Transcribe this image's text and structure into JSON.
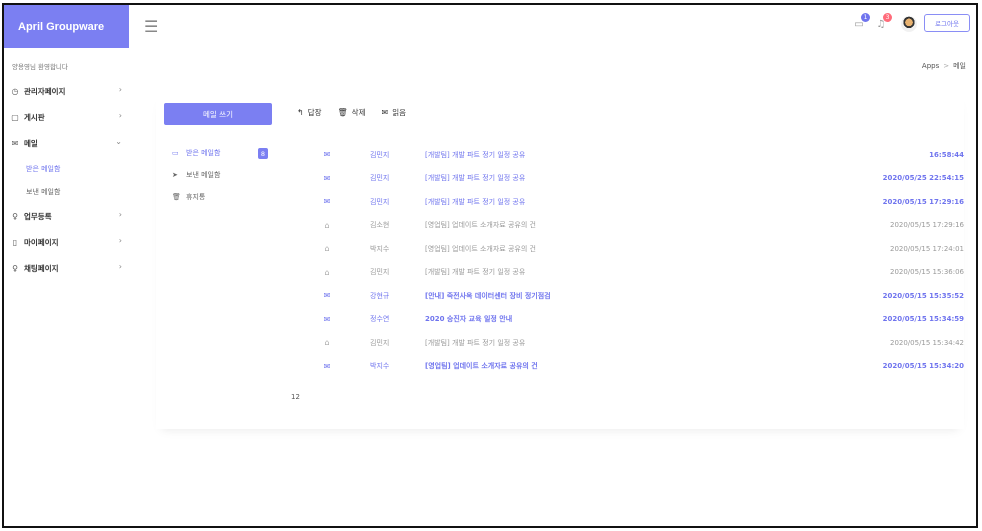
{
  "app": {
    "brand": "April Groupware",
    "welcome": "양용영님 환영합니다"
  },
  "header": {
    "mail_badge": "1",
    "bell_badge": "3",
    "logout_label": "로그아웃",
    "accent": "#7b7ff2",
    "badge_colors": [
      "#6f74ee",
      "#ff6b7a"
    ]
  },
  "breadcrumb": {
    "root": "Apps",
    "separator": ">",
    "current": "메일"
  },
  "sidebar": {
    "items": [
      {
        "label": "관리자페이지",
        "icon": "gauge-icon"
      },
      {
        "label": "게시판",
        "icon": "document-icon"
      },
      {
        "label": "메일",
        "icon": "envelope-icon"
      },
      {
        "label": "업무등록",
        "icon": "bulb-icon"
      },
      {
        "label": "마이페이지",
        "icon": "page-icon"
      },
      {
        "label": "채팅페이지",
        "icon": "bulb-icon"
      }
    ],
    "mail_sub": [
      "받은 메일함",
      "보낸 메일함"
    ]
  },
  "compose_label": "메일 쓰기",
  "toolbar": {
    "reply": "답장",
    "delete": "삭제",
    "read": "읽음"
  },
  "folders": [
    {
      "label": "받은 메일함",
      "count": "8"
    },
    {
      "label": "보낸 메일함"
    },
    {
      "label": "휴지통"
    }
  ],
  "mails": [
    {
      "sender": "김민지",
      "subject": "[개발팀] 개발 파트 정기 일정 공유",
      "date": "16:58:44",
      "unread": true
    },
    {
      "sender": "김민지",
      "subject": "[개발팀] 개발 파트 정기 일정 공유",
      "date": "2020/05/25 22:54:15",
      "unread": true
    },
    {
      "sender": "김민지",
      "subject": "[개발팀] 개발 파트 정기 일정 공유",
      "date": "2020/05/15 17:29:16",
      "unread": true
    },
    {
      "sender": "김소현",
      "subject": "[영업팀] 업데이트 소개자료 공유의 건",
      "date": "2020/05/15 17:29:16",
      "unread": false
    },
    {
      "sender": "박지수",
      "subject": "[영업팀] 업데이트 소개자료 공유의 건",
      "date": "2020/05/15 17:24:01",
      "unread": false
    },
    {
      "sender": "김민지",
      "subject": "[개발팀] 개발 파트 정기 일정 공유",
      "date": "2020/05/15 15:36:06",
      "unread": false
    },
    {
      "sender": "강현규",
      "subject": "[안내] 죽전사옥 데이터센터 장비 정기점검",
      "date": "2020/05/15 15:35:52",
      "unread": true
    },
    {
      "sender": "정수연",
      "subject": "2020 승진자 교육 일정 안내",
      "date": "2020/05/15 15:34:59",
      "unread": true
    },
    {
      "sender": "김민지",
      "subject": "[개발팀] 개발 파트 정기 일정 공유",
      "date": "2020/05/15 15:34:42",
      "unread": false
    },
    {
      "sender": "박지수",
      "subject": "[영업팀] 업데이트 소개자료 공유의 건",
      "date": "2020/05/15 15:34:20",
      "unread": true
    }
  ],
  "pagination": "12"
}
